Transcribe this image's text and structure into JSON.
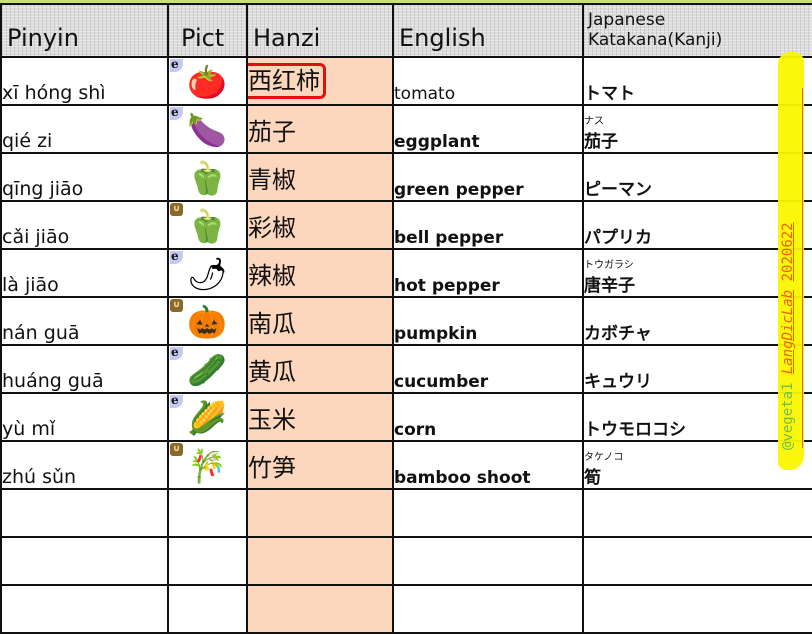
{
  "headers": {
    "pinyin": "Pinyin",
    "pict": "Pict",
    "hanzi": "Hanzi",
    "english": "English",
    "japanese_line1": "Japanese",
    "japanese_line2": "Katakana(Kanji)"
  },
  "rows": [
    {
      "pinyin": "xī hóng shì",
      "badge": "e",
      "pict_icon": "tomato-icon",
      "pict_glyph": "🍅",
      "hanzi": "西红柿",
      "hanzi_highlighted": true,
      "english": "tomato",
      "english_bold": false,
      "jp_ruby": "",
      "jp": "トマト"
    },
    {
      "pinyin": "qié zi",
      "badge": "e",
      "pict_icon": "eggplant-icon",
      "pict_glyph": "🍆",
      "hanzi": "茄子",
      "english": "eggplant",
      "english_bold": true,
      "jp_ruby": "ナス",
      "jp": "茄子"
    },
    {
      "pinyin": "qīng jiāo",
      "badge": "",
      "pict_icon": "green-pepper-icon",
      "pict_glyph": "🫑",
      "hanzi": "青椒",
      "english": "green pepper",
      "english_bold": true,
      "jp_ruby": "",
      "jp": "ピーマン"
    },
    {
      "pinyin": "cǎi jiāo",
      "badge": "u",
      "pict_icon": "bell-pepper-icon",
      "pict_glyph": "🫑",
      "hanzi": "彩椒",
      "english": "bell pepper",
      "english_bold": true,
      "jp_ruby": "",
      "jp": "パプリカ"
    },
    {
      "pinyin": "là jiāo",
      "badge": "e",
      "pict_icon": "hot-pepper-icon",
      "pict_glyph": "🌶",
      "hanzi": "辣椒",
      "english": "hot pepper",
      "english_bold": true,
      "jp_ruby": "トウガラシ",
      "jp": "唐辛子"
    },
    {
      "pinyin": "nán guā",
      "badge": "u",
      "pict_icon": "pumpkin-icon",
      "pict_glyph": "🎃",
      "hanzi": "南瓜",
      "english": "pumpkin",
      "english_bold": true,
      "jp_ruby": "",
      "jp": "カボチャ"
    },
    {
      "pinyin": "huáng guā",
      "badge": "e",
      "pict_icon": "cucumber-icon",
      "pict_glyph": "🥒",
      "hanzi": "黄瓜",
      "english": "cucumber",
      "english_bold": true,
      "jp_ruby": "",
      "jp": "キュウリ"
    },
    {
      "pinyin": "yù mǐ",
      "badge": "e",
      "pict_icon": "corn-icon",
      "pict_glyph": "🌽",
      "hanzi": "玉米",
      "english": "corn",
      "english_bold": true,
      "jp_ruby": "",
      "jp": "トウモロコシ"
    },
    {
      "pinyin": "zhú sǔn",
      "badge": "u",
      "pict_icon": "bamboo-shoot-icon",
      "pict_glyph": "🎋",
      "hanzi": "竹笋",
      "english": "bamboo shoot",
      "english_bold": true,
      "jp_ruby": "タケノコ",
      "jp": "筍"
    }
  ],
  "empty_rows": 3,
  "badges": {
    "e": "e",
    "u": "∪"
  },
  "watermark": {
    "user": "@vegeta1",
    "lab": "LangDicLab",
    "date": "2020622"
  },
  "colors": {
    "hanzi_column_bg": "#fdd7bd",
    "highlight_border": "#e01010",
    "watermark_bg": "#faf700",
    "watermark_user": "#6cc04a",
    "watermark_lab": "#f06000"
  }
}
